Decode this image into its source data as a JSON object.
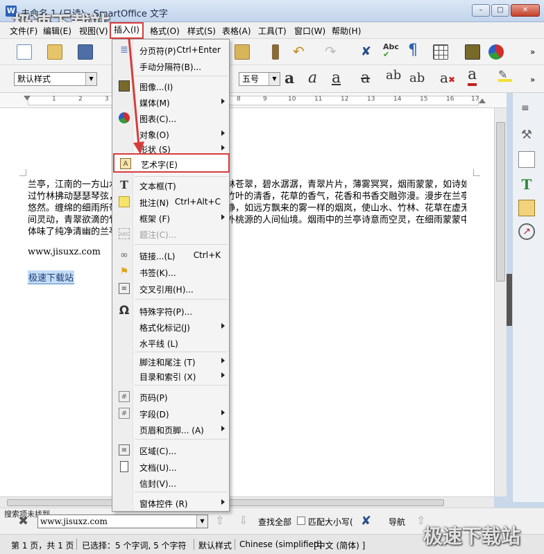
{
  "window": {
    "title": "未命名 1 (只读) - SmartOffice 文字",
    "watermark_top": "极速下载站",
    "watermark_bottom": "极速下载站"
  },
  "menubar": {
    "items": [
      "文件(F)",
      "编辑(E)",
      "视图(V)",
      "插入(I)",
      "格式(O)",
      "样式(S)",
      "表格(A)",
      "工具(T)",
      "窗口(W)",
      "帮助(H)"
    ]
  },
  "toolbar": {
    "style_combo": "默认样式",
    "size_combo": "五号"
  },
  "ruler": {
    "numbers": [
      "1",
      "2",
      "3",
      "4",
      "5",
      "6",
      "7",
      "8",
      "9",
      "10",
      "11",
      "12",
      "13",
      "14",
      "15",
      "16",
      "17"
    ]
  },
  "document": {
    "lines": [
      "兰亭，江南的一方山水，一方大地的灵秀之地。山林苍翠，碧水潺潺，青翠片片，薄雾冥冥，烟雨蒙蒙，如诗如画。风拂",
      "过竹林拂动瑟瑟琴弦，一缕缕的清风飘过，夹杂着竹叶的清香，花草的香气，花香和书香交融弥漫。漫步在兰亭竹径，我心",
      "悠然。缠绵的细雨所带来的朦胧，渲染着兰亭的宁静，如远方飘来的雾一样的烟岚，使山水、竹林、花草在虚无飘渺",
      "间灵动，青翠欲滴的竹叶，带着雨珠，恍若置身世外桃源的人间仙境。烟雨中的兰亭诗意而空灵，在细雨蒙蒙中我真正",
      "体味了纯净清幽的兰亭。"
    ],
    "link": "www.jisuxz.com",
    "selected": "极速下载站"
  },
  "insert_menu": {
    "items": [
      {
        "label": "分页符(P)",
        "shortcut": "Ctrl+Enter",
        "icon": "page-break-icon"
      },
      {
        "label": "手动分隔符(B)...",
        "shortcut": "",
        "icon": ""
      },
      {
        "label": "图像...(I)",
        "shortcut": "",
        "icon": "image-icon"
      },
      {
        "label": "媒体(M)",
        "shortcut": "",
        "icon": ""
      },
      {
        "label": "图表(C)...",
        "shortcut": "",
        "icon": "chart-icon"
      },
      {
        "label": "对象(O)",
        "shortcut": "",
        "icon": ""
      },
      {
        "label": "形状 (S)",
        "shortcut": "",
        "icon": ""
      },
      {
        "label": "艺术字(E)",
        "shortcut": "",
        "icon": "fontwork-icon"
      },
      {
        "label": "文本框(T)",
        "shortcut": "",
        "icon": "text-box-icon"
      },
      {
        "label": "批注(N)",
        "shortcut": "Ctrl+Alt+C",
        "icon": "comment-icon"
      },
      {
        "label": "框架 (F)",
        "shortcut": "",
        "icon": ""
      },
      {
        "label": "题注(C)...",
        "shortcut": "",
        "icon": "caption-icon"
      },
      {
        "label": "链接...(L)",
        "shortcut": "Ctrl+K",
        "icon": "link-icon"
      },
      {
        "label": "书签(K)...",
        "shortcut": "",
        "icon": "bookmark-icon"
      },
      {
        "label": "交叉引用(H)...",
        "shortcut": "",
        "icon": "cross-reference-icon"
      },
      {
        "label": "特殊字符(P)...",
        "shortcut": "",
        "icon": "omega-icon"
      },
      {
        "label": "格式化标记(J)",
        "shortcut": "",
        "icon": ""
      },
      {
        "label": "水平线 (L)",
        "shortcut": "",
        "icon": ""
      },
      {
        "label": "脚注和尾注 (T)",
        "shortcut": "",
        "icon": ""
      },
      {
        "label": "目录和索引 (X)",
        "shortcut": "",
        "icon": ""
      },
      {
        "label": "页码(P)",
        "shortcut": "",
        "icon": "page-number-icon"
      },
      {
        "label": "字段(D)",
        "shortcut": "",
        "icon": "field-icon"
      },
      {
        "label": "页眉和页脚... (A)",
        "shortcut": "",
        "icon": ""
      },
      {
        "label": "区域(C)...",
        "shortcut": "",
        "icon": "section-icon"
      },
      {
        "label": "文档(U)...",
        "shortcut": "",
        "icon": "document-icon"
      },
      {
        "label": "信封(V)...",
        "shortcut": "",
        "icon": ""
      },
      {
        "label": "窗体控件 (R)",
        "shortcut": "",
        "icon": ""
      }
    ]
  },
  "findbar": {
    "label": "搜索项未找到",
    "value": "www.jisuxz.com",
    "find_all": "查找全部",
    "match_case": "匹配大小写(",
    "navigate": "导航"
  },
  "statusbar": {
    "page": "第 1 页，共 1 页",
    "selection": "已选择：5 个字词, 5 个字符",
    "style": "默认样式",
    "language": "Chinese (simplified)",
    "lang_short": "[中文 (简体) ]"
  },
  "colors": {
    "accent_red": "#d83b3b",
    "selection": "#c4dcf5"
  }
}
